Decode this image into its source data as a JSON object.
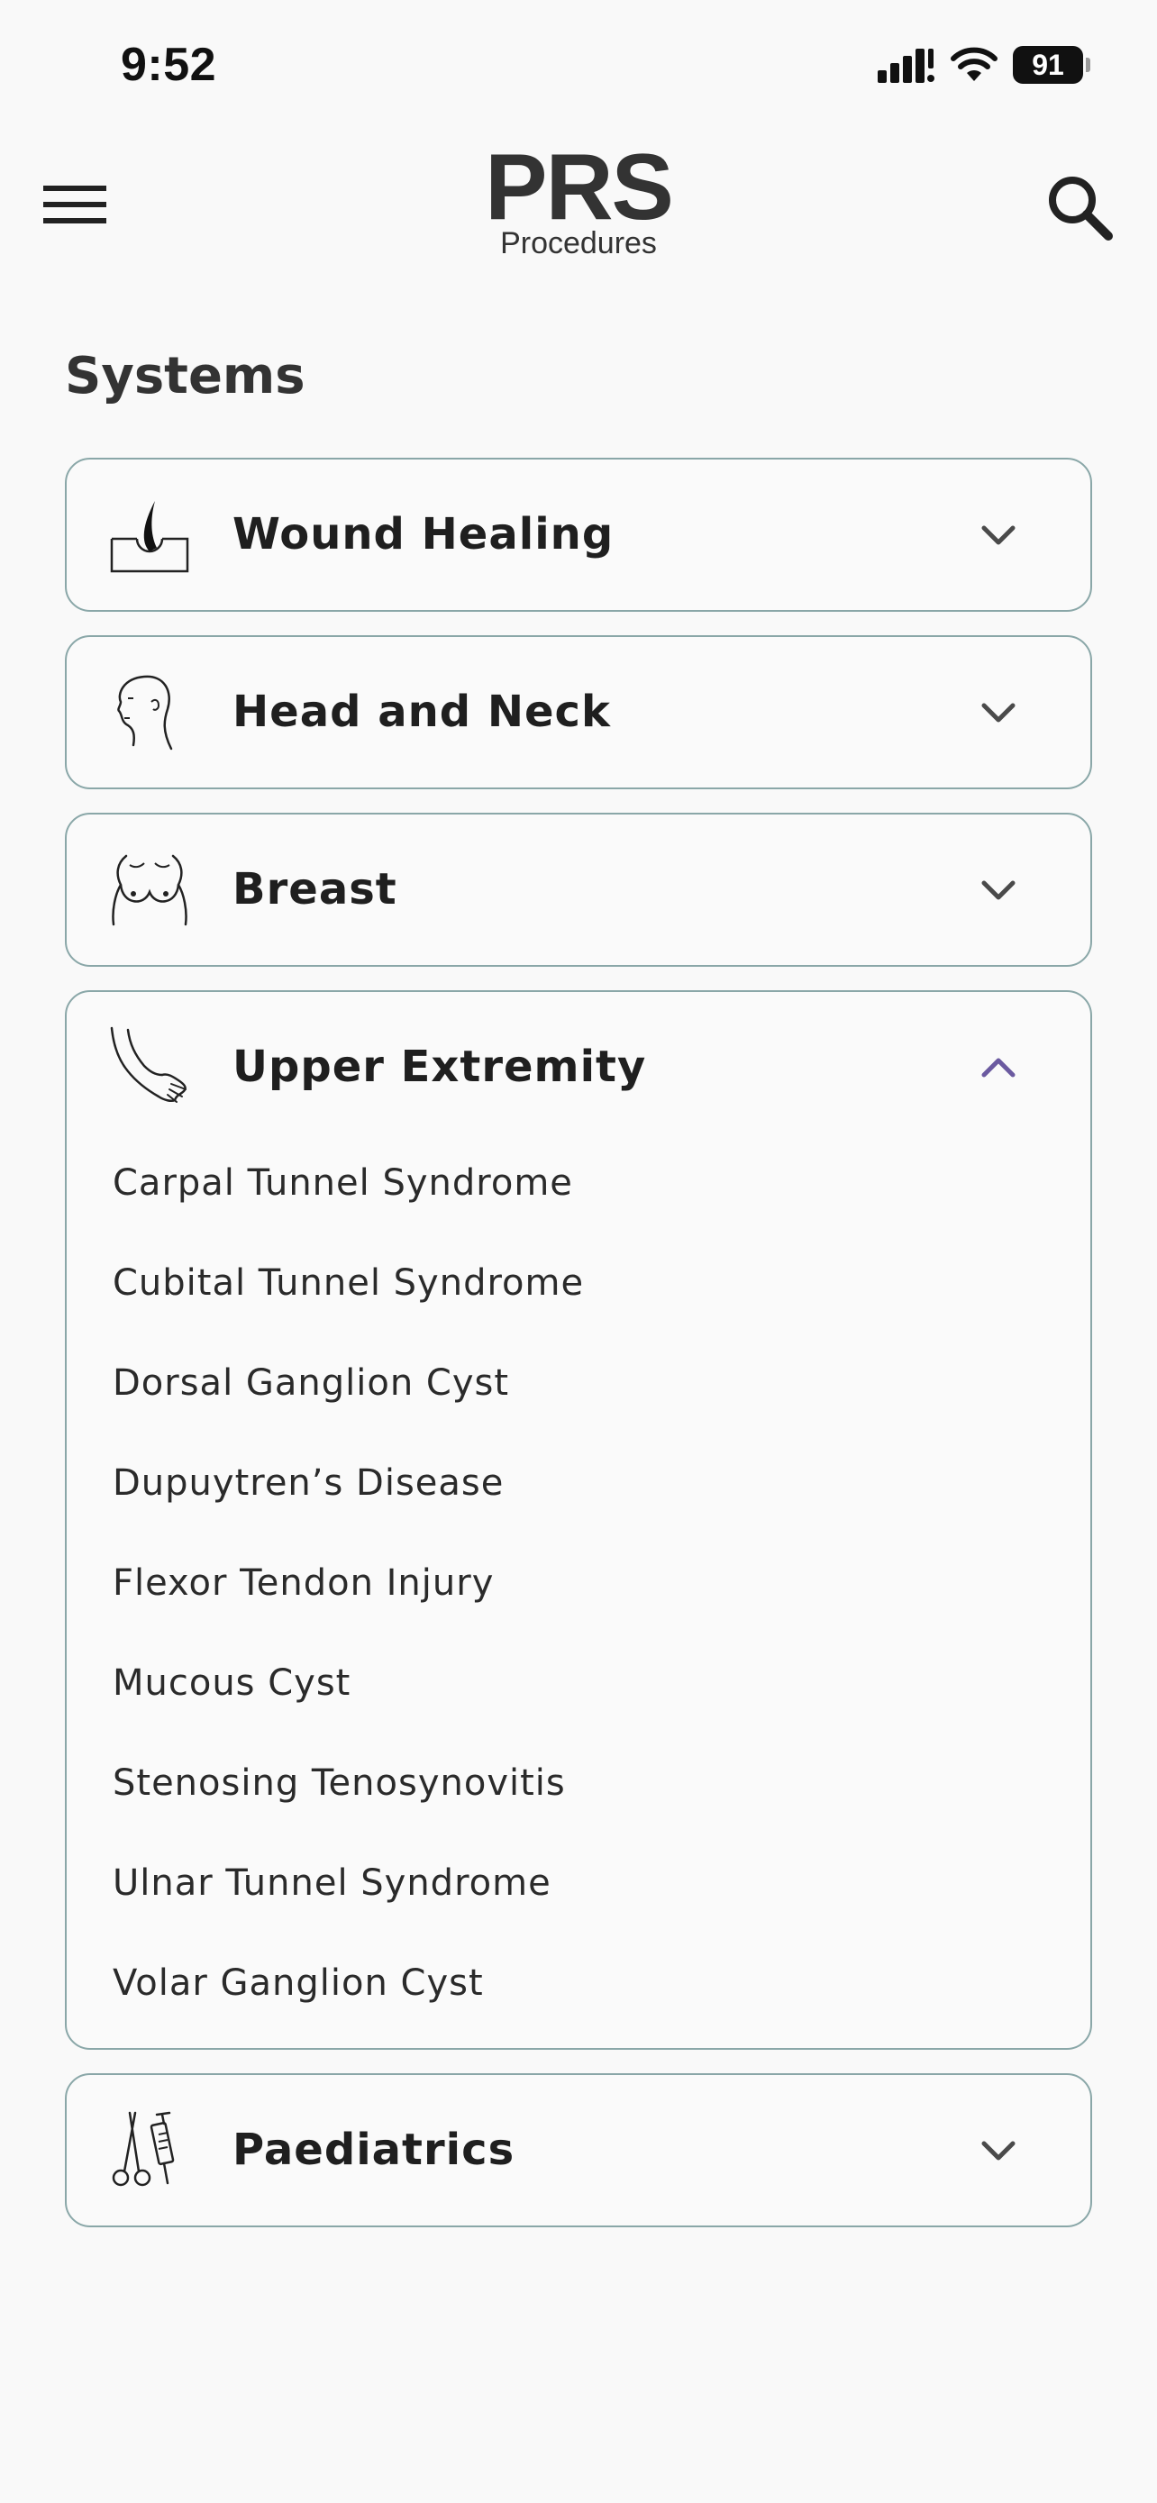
{
  "status_bar": {
    "time": "9:52",
    "battery": "91",
    "icons": [
      "signal-icon",
      "wifi-icon",
      "battery-icon"
    ]
  },
  "header": {
    "logo_main": "PRS",
    "logo_sub": "Procedures",
    "icons": [
      "menu-icon",
      "search-icon"
    ]
  },
  "section_title": "Systems",
  "systems": [
    {
      "title": "Wound Healing",
      "icon": "wound-healing-icon",
      "expanded": false
    },
    {
      "title": "Head and Neck",
      "icon": "head-neck-icon",
      "expanded": false
    },
    {
      "title": "Breast",
      "icon": "breast-icon",
      "expanded": false
    },
    {
      "title": "Upper Extremity",
      "icon": "upper-extremity-icon",
      "expanded": true,
      "items": [
        "Carpal Tunnel Syndrome",
        "Cubital Tunnel Syndrome",
        "Dorsal Ganglion Cyst",
        "Dupuytren’s Disease",
        "Flexor Tendon Injury",
        "Mucous Cyst",
        "Stenosing Tenosynovitis",
        "Ulnar Tunnel Syndrome",
        "Volar Ganglion Cyst"
      ]
    },
    {
      "title": "Paediatrics",
      "icon": "paediatrics-icon",
      "expanded": false
    }
  ],
  "colors": {
    "background": "#f9f9f9",
    "panel_border": "#8aa7a8",
    "chevron": "#4a4a4a",
    "chevron_active": "#6b5aa0",
    "text": "#1f1f1f"
  }
}
